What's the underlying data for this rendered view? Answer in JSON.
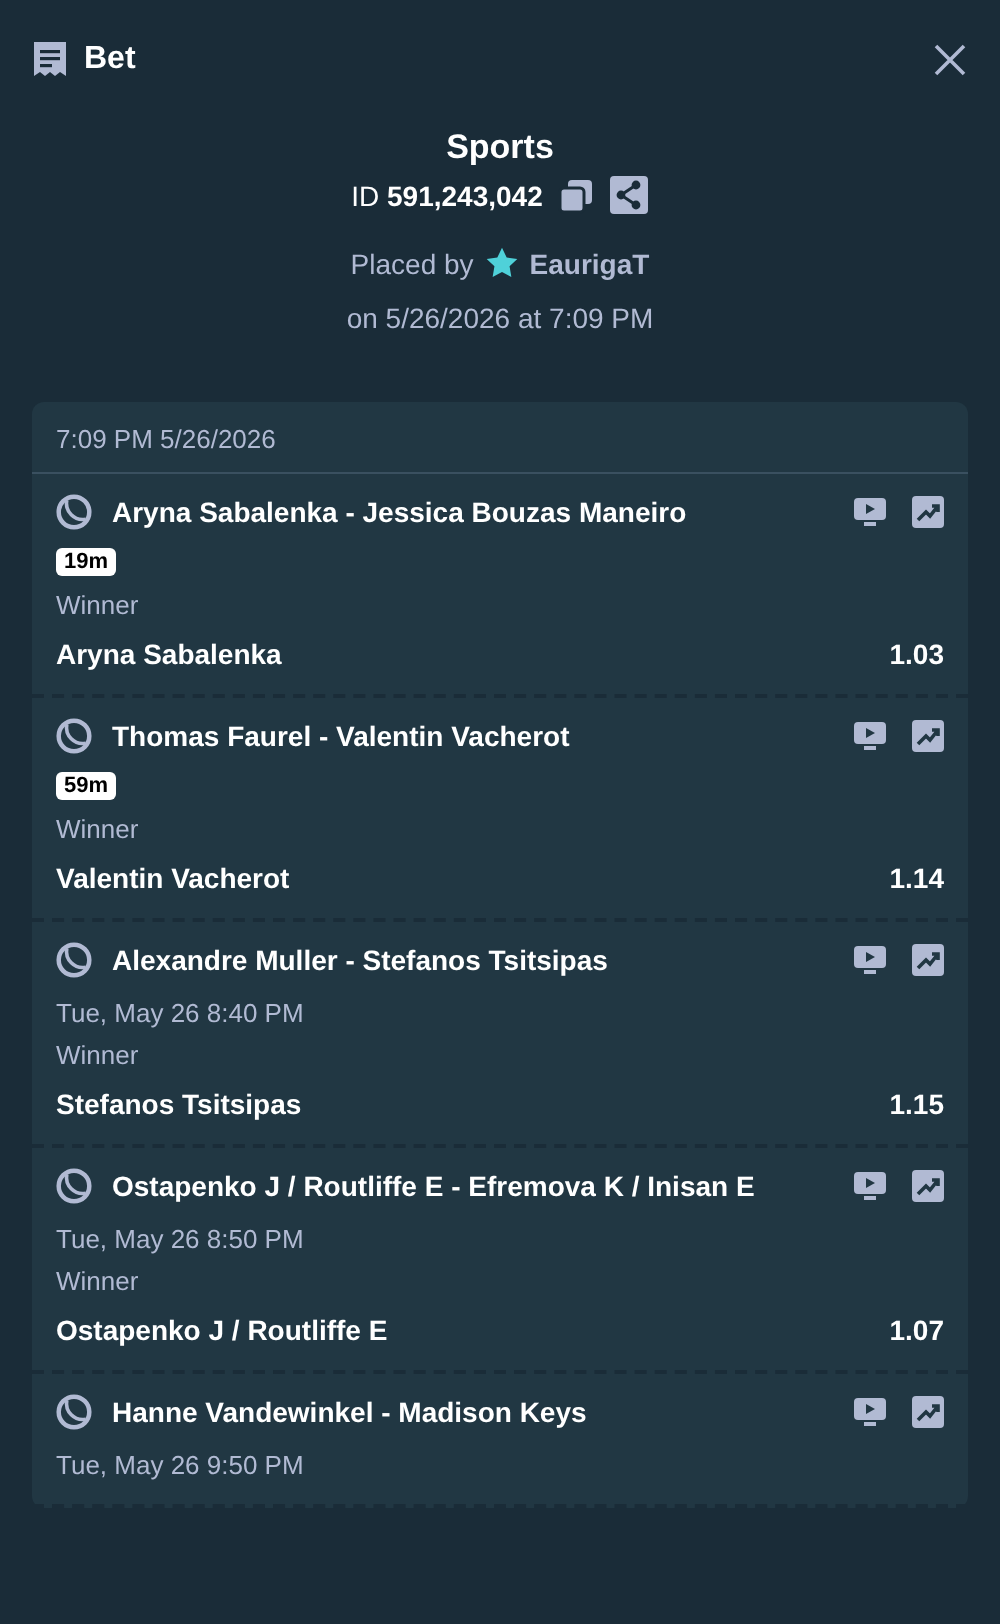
{
  "header": {
    "title": "Bet"
  },
  "summary": {
    "sport": "Sports",
    "id_label": "ID",
    "id_value": "591,243,042",
    "placed_by_label": "Placed by",
    "user": "EaurigaT",
    "placed_on": "on 5/26/2026 at 7:09 PM"
  },
  "slip": {
    "timestamp": "7:09 PM 5/26/2026",
    "events": [
      {
        "match": "Aryna Sabalenka - Jessica Bouzas Maneiro",
        "kind": "live",
        "status": "19m",
        "market": "Winner",
        "selection": "Aryna Sabalenka",
        "odds": "1.03"
      },
      {
        "match": "Thomas Faurel - Valentin Vacherot",
        "kind": "live",
        "status": "59m",
        "market": "Winner",
        "selection": "Valentin Vacherot",
        "odds": "1.14"
      },
      {
        "match": "Alexandre Muller - Stefanos Tsitsipas",
        "kind": "scheduled",
        "status": "Tue, May 26  8:40 PM",
        "market": "Winner",
        "selection": "Stefanos Tsitsipas",
        "odds": "1.15"
      },
      {
        "match": "Ostapenko J / Routliffe E - Efremova K / Inisan E",
        "kind": "scheduled",
        "status": "Tue, May 26  8:50 PM",
        "market": "Winner",
        "selection": "Ostapenko J / Routliffe E",
        "odds": "1.07"
      },
      {
        "match": "Hanne Vandewinkel - Madison Keys",
        "kind": "scheduled",
        "status": "Tue, May 26  9:50 PM"
      }
    ]
  }
}
